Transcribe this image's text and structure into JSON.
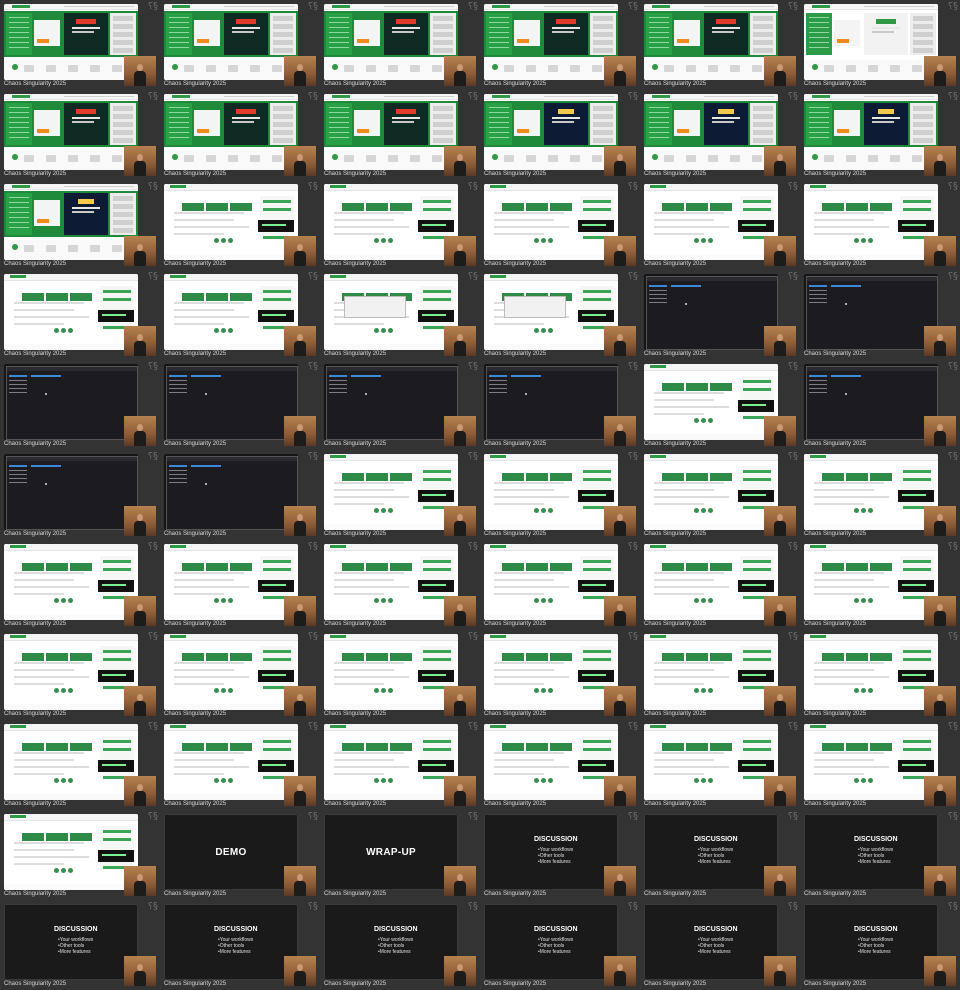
{
  "caption_text": "Chaos Singularity 2025",
  "colors": {
    "background": "#2e2e2e",
    "brand_green": "#2f9a45",
    "promo_orange": "#f08a1c",
    "promo_red": "#e43a2a",
    "dark_app": "#1c1c20",
    "slide_bg": "#1a1a1a"
  },
  "cells": [
    {
      "kind": "web"
    },
    {
      "kind": "web"
    },
    {
      "kind": "web"
    },
    {
      "kind": "web"
    },
    {
      "kind": "web"
    },
    {
      "kind": "web-white"
    },
    {
      "kind": "web"
    },
    {
      "kind": "web"
    },
    {
      "kind": "web"
    },
    {
      "kind": "web-blue"
    },
    {
      "kind": "web-blue"
    },
    {
      "kind": "web-blue"
    },
    {
      "kind": "web-blue"
    },
    {
      "kind": "prod"
    },
    {
      "kind": "prod"
    },
    {
      "kind": "prod"
    },
    {
      "kind": "prod"
    },
    {
      "kind": "prod"
    },
    {
      "kind": "prod"
    },
    {
      "kind": "prod"
    },
    {
      "kind": "prod-popup"
    },
    {
      "kind": "prod-popup"
    },
    {
      "kind": "dark"
    },
    {
      "kind": "dark"
    },
    {
      "kind": "dark"
    },
    {
      "kind": "dark"
    },
    {
      "kind": "dark"
    },
    {
      "kind": "dark"
    },
    {
      "kind": "prod"
    },
    {
      "kind": "dark"
    },
    {
      "kind": "dark"
    },
    {
      "kind": "dark"
    },
    {
      "kind": "prod"
    },
    {
      "kind": "prod"
    },
    {
      "kind": "prod"
    },
    {
      "kind": "prod"
    },
    {
      "kind": "prod"
    },
    {
      "kind": "prod"
    },
    {
      "kind": "prod"
    },
    {
      "kind": "prod"
    },
    {
      "kind": "prod"
    },
    {
      "kind": "prod"
    },
    {
      "kind": "prod"
    },
    {
      "kind": "prod"
    },
    {
      "kind": "prod"
    },
    {
      "kind": "prod"
    },
    {
      "kind": "prod"
    },
    {
      "kind": "prod"
    },
    {
      "kind": "prod"
    },
    {
      "kind": "prod"
    },
    {
      "kind": "prod"
    },
    {
      "kind": "prod"
    },
    {
      "kind": "prod"
    },
    {
      "kind": "prod"
    },
    {
      "kind": "prod"
    },
    {
      "kind": "slide-title",
      "title": "DEMO"
    },
    {
      "kind": "slide-title",
      "title": "WRAP-UP"
    },
    {
      "kind": "slide-discussion"
    },
    {
      "kind": "slide-discussion"
    },
    {
      "kind": "slide-discussion"
    },
    {
      "kind": "slide-discussion"
    },
    {
      "kind": "slide-discussion"
    },
    {
      "kind": "slide-discussion"
    },
    {
      "kind": "slide-discussion"
    },
    {
      "kind": "slide-discussion"
    },
    {
      "kind": "slide-discussion"
    }
  ],
  "discussion": {
    "title": "DISCUSSION",
    "bullets": [
      "Your workflows",
      "Other tools",
      "More features"
    ]
  },
  "icons": {
    "corner_icon": "spiral-logo-icon"
  }
}
